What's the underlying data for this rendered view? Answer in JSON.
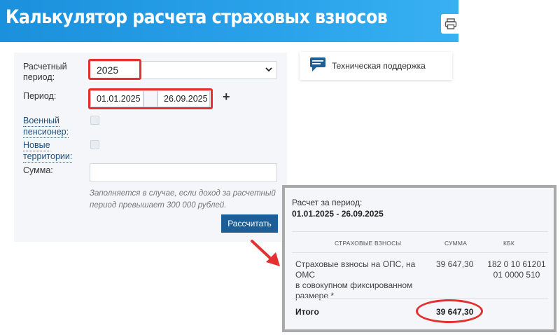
{
  "header": {
    "title": "Калькулятор расчета страховых взносов"
  },
  "form": {
    "period_label": "Расчетный период:",
    "period_label_line1": "Расчетный",
    "period_label_line2": "период:",
    "period_value": "2025",
    "dates_label": "Период:",
    "date_from": "01.01.2025",
    "date_to": "26.09.2025",
    "add_symbol": "+",
    "military_line1": "Военный",
    "military_line2": "пенсионер:",
    "territories_line1": "Новые",
    "territories_line2": "территории:",
    "sum_label": "Сумма:",
    "sum_value": "",
    "hint": "Заполняется в случае, если доход за расчетный период превышает 300 000 рублей.",
    "calculate_button": "Рассчитать"
  },
  "support": {
    "label": "Техническая поддержка"
  },
  "result": {
    "caption": "Расчет за период:",
    "period": "01.01.2025 - 26.09.2025",
    "columns": [
      "СТРАХОВЫЕ ВЗНОСЫ",
      "СУММА",
      "КБК"
    ],
    "rows": [
      {
        "name_lines": [
          "Страховые взносы на ОПС, на ОМС",
          "в совокупном фиксированном",
          "размере *"
        ],
        "sum": "39 647,30",
        "kbk_lines": [
          "182 0 10 61201",
          "01 0000 510"
        ]
      }
    ],
    "total_label": "Итого",
    "total_value": "39 647,30"
  },
  "colors": {
    "header": "#2aa2ea",
    "button": "#1d5e96",
    "highlight": "#e53030",
    "link": "#1f4f7a"
  }
}
